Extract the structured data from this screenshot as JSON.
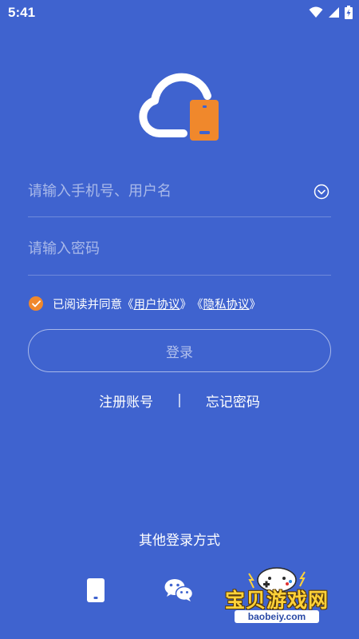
{
  "status_bar": {
    "time": "5:41"
  },
  "login_form": {
    "username_placeholder": "请输入手机号、用户名",
    "password_placeholder": "请输入密码",
    "agreement_prefix": "已阅读并同意",
    "bracket_open": "《",
    "bracket_close": "》",
    "user_agreement": "用户协议",
    "privacy_agreement": "隐私协议",
    "login_label": "登录"
  },
  "links": {
    "register": "注册账号",
    "separator": "|",
    "forgot_password": "忘记密码"
  },
  "other_login": {
    "title": "其他登录方式"
  },
  "watermark": {
    "text": "宝贝游戏网",
    "url": "baobeiy.com"
  },
  "colors": {
    "background": "#3f63cf",
    "accent": "#f0882c",
    "text": "#ffffff"
  }
}
